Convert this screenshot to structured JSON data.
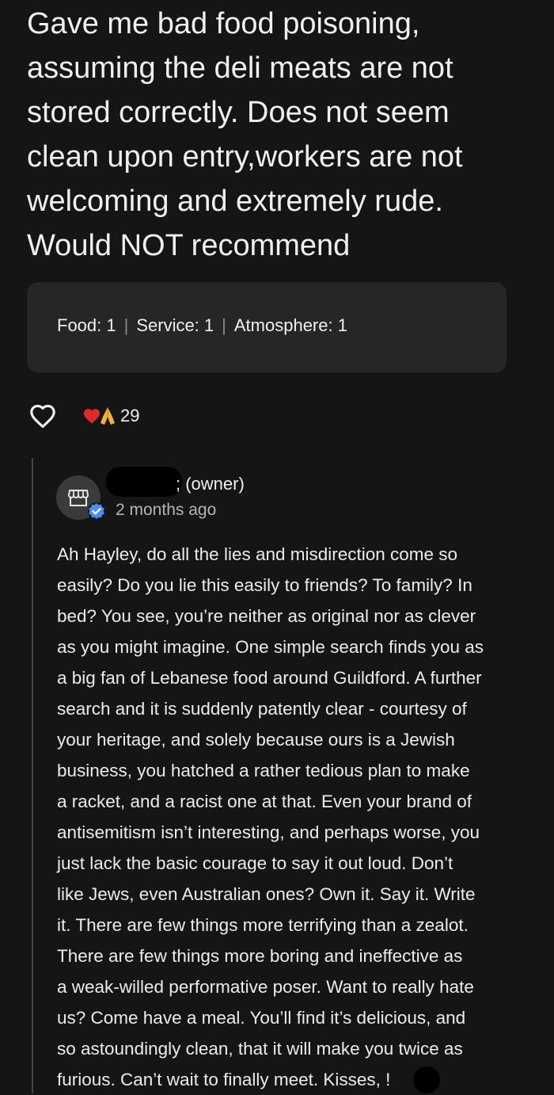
{
  "review": {
    "lines": [
      "Gave me bad food poisoning,",
      "assuming the deli meats are not",
      "stored correctly. Does not seem",
      "clean upon entry,workers are not",
      "welcoming and extremely rude.",
      "Would NOT recommend"
    ],
    "ratings": {
      "food": "Food: 1",
      "service": "Service: 1",
      "atmosphere": "Atmosphere: 1",
      "separator": "|"
    }
  },
  "reactions": {
    "icon": "heart-outline-icon",
    "emojis": [
      "red-heart",
      "folded-hands"
    ],
    "count": "29"
  },
  "owner_reply": {
    "avatar_icon": "storefront-icon",
    "verified_icon": "verified-check-icon",
    "name_suffix": "; (owner)",
    "time": "2 months ago",
    "lines": [
      "Ah Hayley, do all the lies and misdirection come so",
      "easily? Do you lie this easily to friends? To family? In",
      "bed? You see, you’re neither as original nor as clever",
      "as you might imagine. One simple search finds you as",
      "a big fan of Lebanese food around Guildford. A further",
      "search and it is suddenly patently clear - courtesy of",
      "your heritage, and solely because ours is a Jewish",
      "business, you hatched a rather tedious plan to make",
      "a racket, and a racist one at that. Even your brand of",
      "antisemitism isn’t interesting, and perhaps worse, you",
      "just lack the basic courage to say it out loud. Don’t",
      "like Jews, even Australian ones? Own it. Say it. Write",
      "it. There are few things more terrifying than a zealot.",
      "There are few things more boring and ineffective as",
      "a weak-willed performative poser. Want to really hate",
      "us? Come have a meal. You’ll find it’s delicious, and",
      "so astoundingly clean, that it will make you twice as",
      "furious. Can’t wait to finally meet. Kisses, !"
    ]
  },
  "colors": {
    "background": "#151515",
    "card": "#262626",
    "verified_blue": "#4a8df8",
    "heart_red": "#e02a2a",
    "hands_yellow": "#f2b233"
  }
}
